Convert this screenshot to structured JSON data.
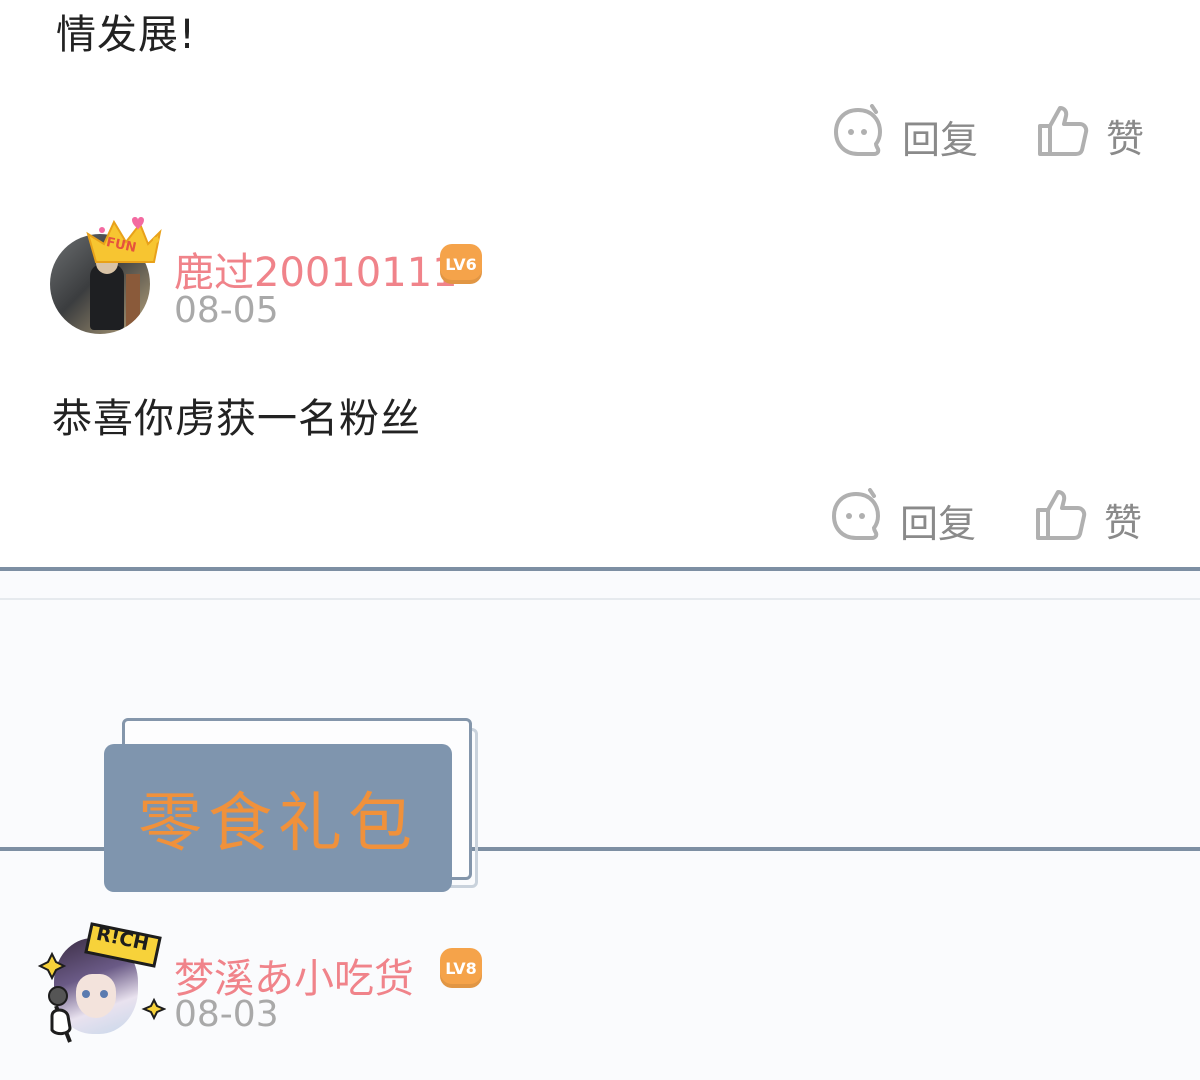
{
  "comment_prev": {
    "text_tail": "情发展!",
    "reply_label": "回复",
    "like_label": "赞"
  },
  "comment_1": {
    "username": "鹿过20010111",
    "level": "LV6",
    "date": "08-05",
    "avatar_badge": "FUN",
    "text": "恭喜你虏获一名粉丝",
    "reply_label": "回复",
    "like_label": "赞"
  },
  "banner": {
    "label": "零食礼包"
  },
  "comment_2": {
    "username": "梦溪あ小吃货",
    "level": "LV8",
    "date": "08-03",
    "avatar_badge": "R!CH"
  },
  "colors": {
    "username": "#f0838a",
    "level_badge": "#f5a34a",
    "divider": "#7d8fa3",
    "banner_bg": "#7f95ae",
    "banner_text": "#f0913b"
  }
}
